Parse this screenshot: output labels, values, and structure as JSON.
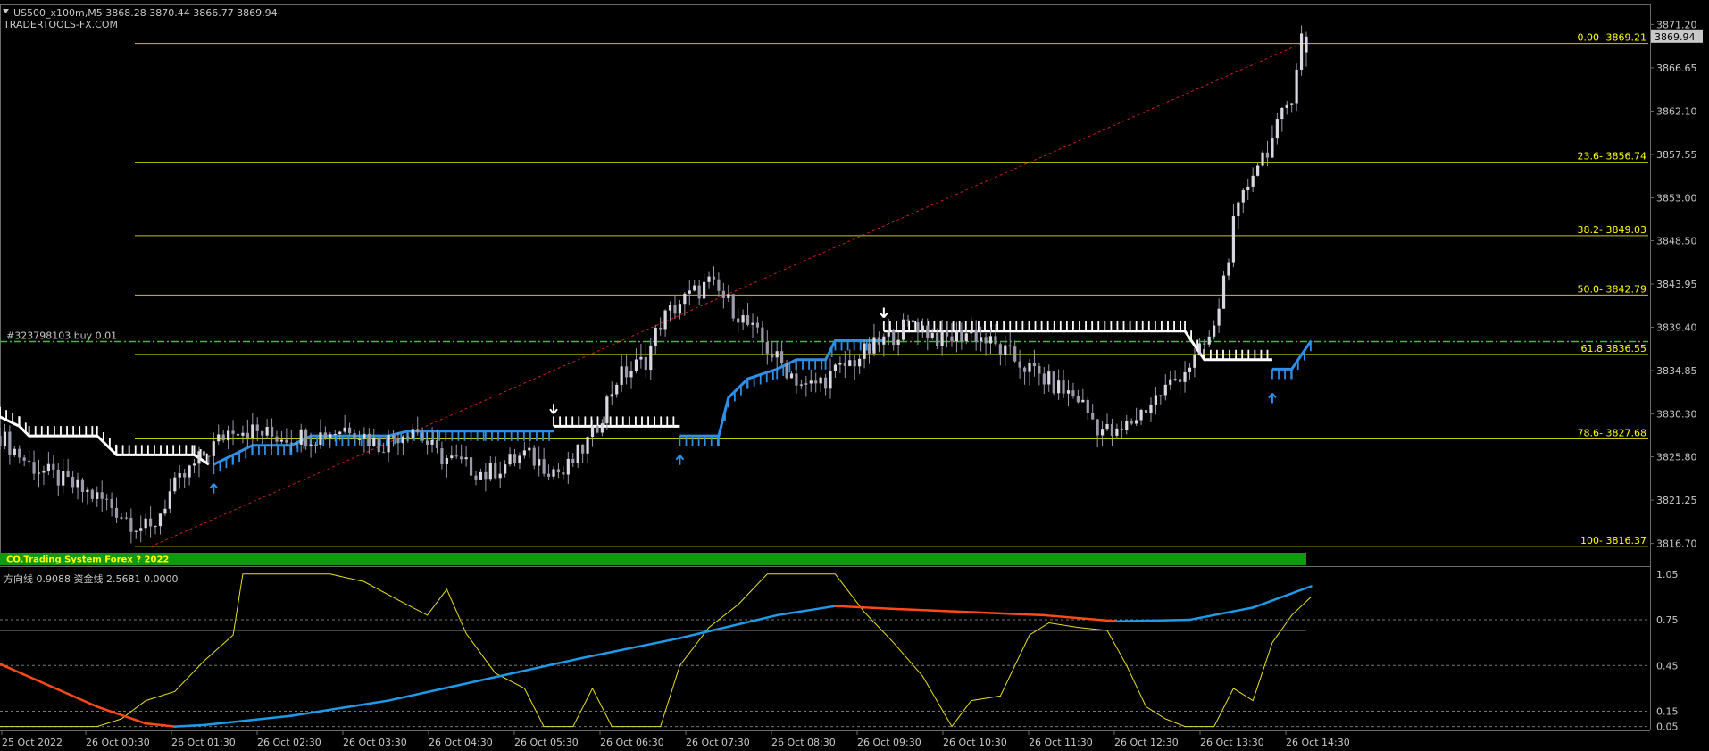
{
  "header": {
    "symbol_line": "US500_x100m,M5  3868.28 3870.44 3866.77 3869.94",
    "watermark": "TRADERTOOLS-FX.COM"
  },
  "price_axis": {
    "labels": [
      "3871.20",
      "3866.65",
      "3862.10",
      "3857.55",
      "3853.00",
      "3848.50",
      "3843.95",
      "3839.40",
      "3834.85",
      "3830.30",
      "3825.80",
      "3821.25",
      "3816.70"
    ],
    "current_price": "3869.94"
  },
  "fibonacci": [
    {
      "level": 0,
      "price": 3869.21,
      "label": "0.00- 3869.21"
    },
    {
      "level": 23.6,
      "price": 3856.74,
      "label": "23.6- 3856.74"
    },
    {
      "level": 38.2,
      "price": 3849.03,
      "label": "38.2- 3849.03"
    },
    {
      "level": 50.0,
      "price": 3842.79,
      "label": "50.0- 3842.79"
    },
    {
      "level": 61.8,
      "price": 3836.55,
      "label": "61.8 3836.55"
    },
    {
      "level": 78.6,
      "price": 3827.68,
      "label": "78.6- 3827.68"
    },
    {
      "level": 100,
      "price": 3816.37,
      "label": "100- 3816.37"
    }
  ],
  "order_line": {
    "label": "#323798103 buy 0.01",
    "price": 3837.9
  },
  "banner": {
    "text": "CO.Trading System Forex  ? 2022"
  },
  "indicator": {
    "label": "方向线 0.9088  资金线 2.5681 0.0000",
    "axis_labels": [
      "1.05",
      "0.75",
      "0.45",
      "0.15",
      "0.05"
    ]
  },
  "time_axis": [
    "25 Oct 2022",
    "26 Oct 00:30",
    "26 Oct 01:30",
    "26 Oct 02:30",
    "26 Oct 03:30",
    "26 Oct 04:30",
    "26 Oct 05:30",
    "26 Oct 06:30",
    "26 Oct 07:30",
    "26 Oct 08:30",
    "26 Oct 09:30",
    "26 Oct 10:30",
    "26 Oct 11:30",
    "26 Oct 12:30",
    "26 Oct 13:30",
    "26 Oct 14:30"
  ],
  "colors": {
    "background": "#000000",
    "fib": "#c8c800",
    "fib_label": "#ffff00",
    "bull_band": "#2e8fe6",
    "bear_band": "#ffffff",
    "candle": "#9a9aaa",
    "order_line": "#22cc22",
    "trend_line": "#cc2020",
    "banner": "#119911",
    "banner_text": "#ffff00",
    "direction_line": "#e8e020",
    "fund_up": "#1e9be8",
    "fund_down": "#ff4a18"
  },
  "chart_data": {
    "type": "line",
    "chart_kind": "candlestick",
    "symbol": "US500_x100m,M5",
    "last_bar": {
      "open": 3868.28,
      "high": 3870.44,
      "low": 3866.77,
      "close": 3869.94
    },
    "price_ylim": [
      3814.6,
      3873.3
    ],
    "indicator_ylim": [
      0.03,
      1.09
    ],
    "close_waypoints": [
      [
        0,
        3828
      ],
      [
        6,
        3825
      ],
      [
        14,
        3823
      ],
      [
        22,
        3821
      ],
      [
        27,
        3819
      ],
      [
        31,
        3818
      ],
      [
        35,
        3822
      ],
      [
        42,
        3826
      ],
      [
        48,
        3829
      ],
      [
        56,
        3828
      ],
      [
        65,
        3828
      ],
      [
        72,
        3829
      ],
      [
        78,
        3827
      ],
      [
        85,
        3829
      ],
      [
        90,
        3826
      ],
      [
        100,
        3824
      ],
      [
        108,
        3826
      ],
      [
        116,
        3824
      ],
      [
        122,
        3828
      ],
      [
        127,
        3834
      ],
      [
        133,
        3836
      ],
      [
        136,
        3840
      ],
      [
        140,
        3842
      ],
      [
        146,
        3844
      ],
      [
        150,
        3842
      ],
      [
        155,
        3839
      ],
      [
        160,
        3836
      ],
      [
        166,
        3833
      ],
      [
        170,
        3834
      ],
      [
        176,
        3836
      ],
      [
        182,
        3838
      ],
      [
        188,
        3840
      ],
      [
        194,
        3838
      ],
      [
        200,
        3839
      ],
      [
        206,
        3837
      ],
      [
        212,
        3835
      ],
      [
        218,
        3833
      ],
      [
        222,
        3832
      ],
      [
        226,
        3829
      ],
      [
        230,
        3828
      ],
      [
        234,
        3830
      ],
      [
        238,
        3832
      ],
      [
        242,
        3834
      ],
      [
        246,
        3836
      ],
      [
        250,
        3839
      ],
      [
        254,
        3850
      ],
      [
        258,
        3856
      ],
      [
        262,
        3859
      ],
      [
        266,
        3864
      ],
      [
        268,
        3870
      ]
    ],
    "series": [
      {
        "name": "方向线",
        "points": [
          [
            0,
            0.05
          ],
          [
            20,
            0.05
          ],
          [
            25,
            0.1
          ],
          [
            30,
            0.22
          ],
          [
            36,
            0.28
          ],
          [
            42,
            0.48
          ],
          [
            48,
            0.65
          ],
          [
            50,
            1.05
          ],
          [
            68,
            1.05
          ],
          [
            75,
            1.0
          ],
          [
            82,
            0.88
          ],
          [
            88,
            0.78
          ],
          [
            92,
            0.95
          ],
          [
            96,
            0.66
          ],
          [
            102,
            0.4
          ],
          [
            108,
            0.3
          ],
          [
            112,
            0.05
          ],
          [
            118,
            0.05
          ],
          [
            122,
            0.3
          ],
          [
            126,
            0.05
          ],
          [
            136,
            0.05
          ],
          [
            140,
            0.45
          ],
          [
            146,
            0.7
          ],
          [
            152,
            0.85
          ],
          [
            158,
            1.05
          ],
          [
            172,
            1.05
          ],
          [
            178,
            0.8
          ],
          [
            184,
            0.6
          ],
          [
            190,
            0.38
          ],
          [
            196,
            0.05
          ],
          [
            200,
            0.22
          ],
          [
            206,
            0.25
          ],
          [
            212,
            0.65
          ],
          [
            216,
            0.73
          ],
          [
            222,
            0.7
          ],
          [
            228,
            0.68
          ],
          [
            232,
            0.45
          ],
          [
            236,
            0.18
          ],
          [
            240,
            0.1
          ],
          [
            244,
            0.05
          ],
          [
            250,
            0.05
          ],
          [
            254,
            0.3
          ],
          [
            258,
            0.22
          ],
          [
            262,
            0.6
          ],
          [
            266,
            0.78
          ],
          [
            270,
            0.9
          ]
        ]
      },
      {
        "name": "资金线",
        "points": [
          [
            0,
            0.46
          ],
          [
            10,
            0.32
          ],
          [
            20,
            0.18
          ],
          [
            30,
            0.07
          ],
          [
            36,
            0.05
          ],
          [
            42,
            0.06
          ],
          [
            60,
            0.12
          ],
          [
            80,
            0.22
          ],
          [
            100,
            0.36
          ],
          [
            120,
            0.5
          ],
          [
            140,
            0.63
          ],
          [
            160,
            0.78
          ],
          [
            172,
            0.84
          ],
          [
            185,
            0.82
          ],
          [
            200,
            0.8
          ],
          [
            215,
            0.78
          ],
          [
            230,
            0.74
          ],
          [
            245,
            0.75
          ],
          [
            258,
            0.83
          ],
          [
            270,
            0.97
          ]
        ]
      }
    ]
  }
}
